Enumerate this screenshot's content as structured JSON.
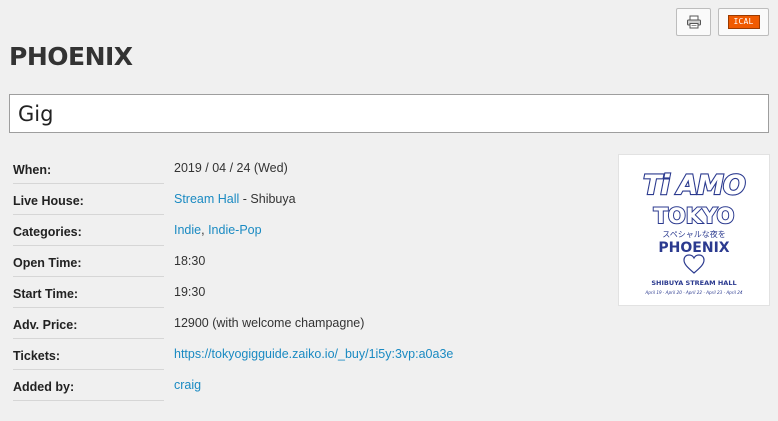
{
  "toolbar": {
    "print_icon": "printer-icon",
    "ical_label": "ICAL"
  },
  "event": {
    "title": "PHOENIX",
    "type": "Gig"
  },
  "details": {
    "when_label": "When:",
    "when_value": "2019 / 04 / 24 (Wed)",
    "venue_label": "Live House:",
    "venue_name": "Stream Hall",
    "venue_area": " - Shibuya",
    "categories_label": "Categories:",
    "category_1": "Indie",
    "category_sep": ", ",
    "category_2": "Indie-Pop",
    "open_label": "Open Time:",
    "open_value": "18:30",
    "start_label": "Start Time:",
    "start_value": "19:30",
    "price_label": "Adv. Price:",
    "price_value": "12900 (with welcome champagne)",
    "tickets_label": "Tickets:",
    "tickets_url": "https://tokyogigguide.zaiko.io/_buy/1i5y:3vp:a0a3e",
    "added_label": "Added by:",
    "added_value": "craig"
  },
  "poster": {
    "line1": "Ti AMO",
    "line2": "TOKYO",
    "jp_text": "スペシャルな夜を",
    "artist": "PHOENIX",
    "venue": "SHIBUYA STREAM HALL",
    "dates": "April 19 · April 20 · April 22 · April 23 · April 24",
    "heart_icon": "heart-icon",
    "ink_color": "#2b3a8f"
  },
  "colors": {
    "link": "#1a8ac2",
    "background": "#f0f0f0",
    "ical_orange": "#f05a00"
  }
}
